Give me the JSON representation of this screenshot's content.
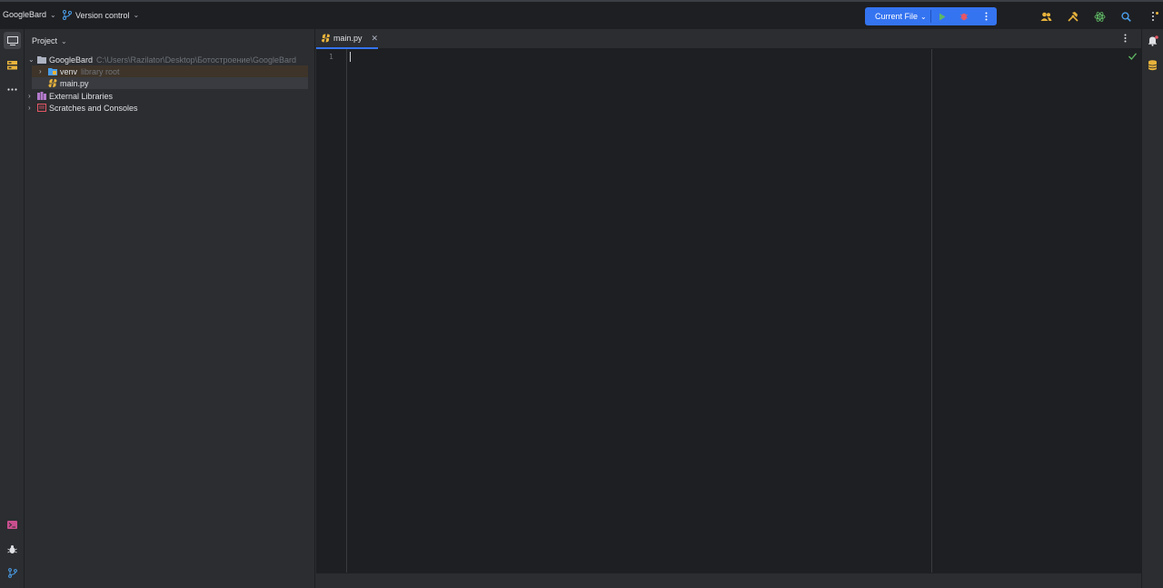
{
  "topbar": {
    "project_name": "GoogleBard",
    "vcs_label": "Version control",
    "run_config": "Current File"
  },
  "project_panel": {
    "title": "Project",
    "tree": {
      "root_name": "GoogleBard",
      "root_path": "C:\\Users\\Razilator\\Desktop\\Ботостроение\\GoogleBard",
      "venv_name": "venv",
      "venv_hint": "library root",
      "file_name": "main.py",
      "external_libraries": "External Libraries",
      "scratches": "Scratches and Consoles"
    }
  },
  "editor": {
    "tab_label": "main.py",
    "line_numbers": [
      "1"
    ]
  },
  "colors": {
    "accent": "#3574f0",
    "run_green": "#5fb865",
    "debug_red": "#e55765",
    "folder_gray": "#aeb3c2",
    "python_yellow": "#e8b33c"
  },
  "icons": [
    "branch-icon",
    "play-icon",
    "debug-icon",
    "more-vertical-icon",
    "people-icon",
    "hammer-icon",
    "atom-icon",
    "search-icon",
    "project-icon",
    "structure-icon",
    "more-horizontal-icon",
    "terminal-icon",
    "bug-icon",
    "git-icon",
    "notifications-icon",
    "database-icon",
    "checkmark-icon"
  ]
}
